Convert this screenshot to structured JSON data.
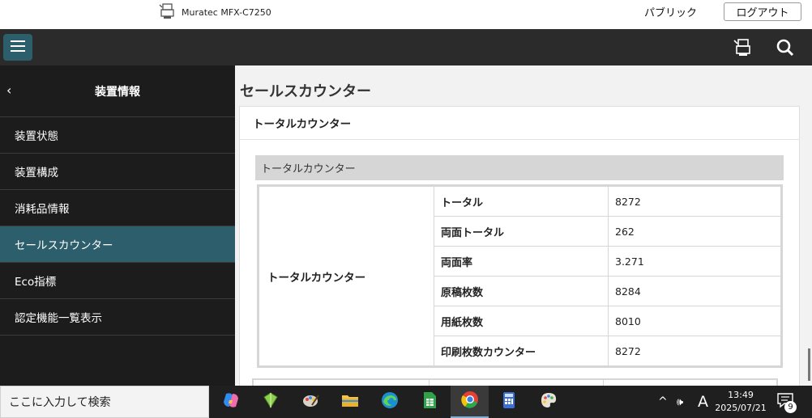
{
  "header": {
    "device_name": "Muratec MFX-C7250",
    "access_mode": "パブリック",
    "logout_label": "ログアウト"
  },
  "navbar": {
    "icons": [
      "menu-icon",
      "printer-icon",
      "search-icon"
    ]
  },
  "sidebar": {
    "back_symbol": "‹",
    "title": "装置情報",
    "items": [
      {
        "label": "装置状態",
        "active": false
      },
      {
        "label": "装置構成",
        "active": false
      },
      {
        "label": "消耗品情報",
        "active": false
      },
      {
        "label": "セールスカウンター",
        "active": true
      },
      {
        "label": "Eco指標",
        "active": false
      },
      {
        "label": "認定機能一覧表示",
        "active": false
      }
    ]
  },
  "main": {
    "page_title": "セールスカウンター",
    "panel_title": "トータルカウンター",
    "section_title": "トータルカウンター",
    "table": {
      "group_label": "トータルカウンター",
      "rows": [
        {
          "label": "トータル",
          "value": "8272"
        },
        {
          "label": "両面トータル",
          "value": "262"
        },
        {
          "label": "両面率",
          "value": "3.271"
        },
        {
          "label": "原稿枚数",
          "value": "8284"
        },
        {
          "label": "用紙枚数",
          "value": "8010"
        },
        {
          "label": "印刷枚数カウンター",
          "value": "8272"
        }
      ]
    }
  },
  "taskbar": {
    "search_placeholder": "ここに入力して検索",
    "apps": [
      "copilot-icon",
      "green-app-icon",
      "paint-app-icon",
      "file-explorer-icon",
      "edge-icon",
      "spreadsheet-icon",
      "chrome-icon",
      "calculator-icon",
      "paint-palette-icon"
    ],
    "tray_chevron": "^",
    "volume_symbol": "🕪",
    "ime_indicator": "A",
    "time": "13:49",
    "date": "2025/07/21",
    "notification_count": "9"
  },
  "colors": {
    "navbar_bg": "#2b2b2b",
    "sidebar_bg": "#1c1c1c",
    "accent": "#2d5e6b",
    "section_bg": "#d6d6d6"
  }
}
